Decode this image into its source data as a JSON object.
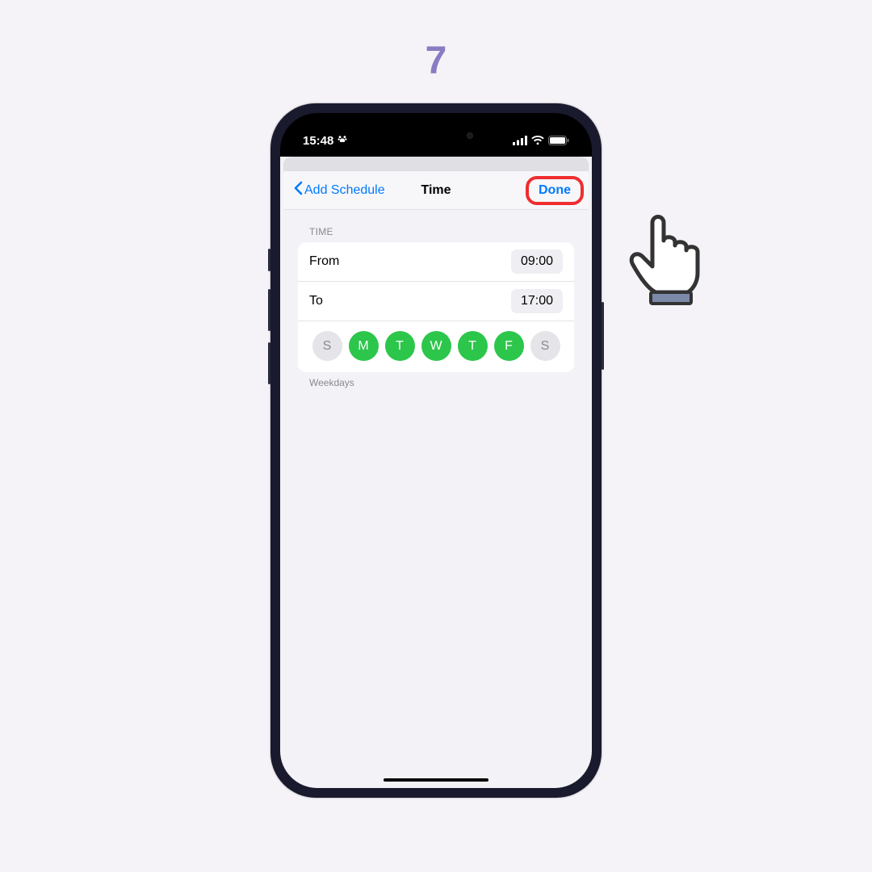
{
  "step_number": "7",
  "status": {
    "time": "15:48",
    "paw_icon": "paw"
  },
  "nav": {
    "back_label": "Add Schedule",
    "title": "Time",
    "done_label": "Done"
  },
  "section": {
    "header": "TIME",
    "footer": "Weekdays"
  },
  "rows": {
    "from_label": "From",
    "from_value": "09:00",
    "to_label": "To",
    "to_value": "17:00"
  },
  "days": [
    {
      "letter": "S",
      "active": false
    },
    {
      "letter": "M",
      "active": true
    },
    {
      "letter": "T",
      "active": true
    },
    {
      "letter": "W",
      "active": true
    },
    {
      "letter": "T",
      "active": true
    },
    {
      "letter": "F",
      "active": true
    },
    {
      "letter": "S",
      "active": false
    }
  ]
}
